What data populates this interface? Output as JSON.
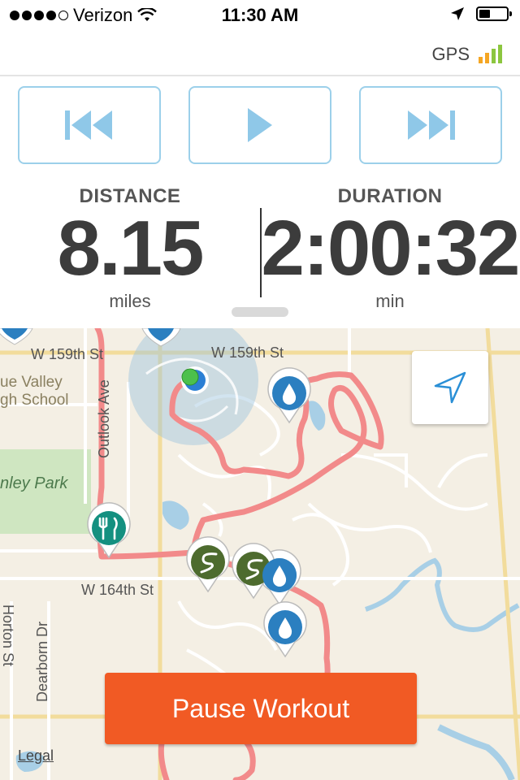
{
  "status_bar": {
    "carrier": "Verizon",
    "time": "11:30 AM",
    "signal_dots_filled": 4,
    "signal_dots_total": 5,
    "battery_level": 0.4
  },
  "gps": {
    "label": "GPS",
    "bar_colors": [
      "#f5a623",
      "#f5a623",
      "#8cc63f",
      "#8cc63f"
    ]
  },
  "controls": {
    "icons": [
      "skip-back-icon",
      "play-icon",
      "skip-forward-icon"
    ],
    "accent": "#8fc8e8"
  },
  "stats": {
    "distance": {
      "label": "DISTANCE",
      "value": "8.15",
      "unit": "miles"
    },
    "duration": {
      "label": "DURATION",
      "value": "2:00:32",
      "unit": "min"
    }
  },
  "map": {
    "streets": {
      "w159_left": "W 159th St",
      "w159_right": "W 159th St",
      "outlook": "Outlook Ave",
      "w164": "W 164th St",
      "dearborn": "Dearborn Dr",
      "horton": "Horton St"
    },
    "places": {
      "school_line1": "ue Valley",
      "school_line2": "gh School",
      "park": "nley Park"
    },
    "route_color": "#f28a8a",
    "marker_types": [
      "water-drop",
      "water-drop",
      "water-drop",
      "restaurant",
      "trail",
      "trail"
    ]
  },
  "pause_button": {
    "label": "Pause Workout",
    "color": "#f15a24"
  },
  "legal": "Legal"
}
